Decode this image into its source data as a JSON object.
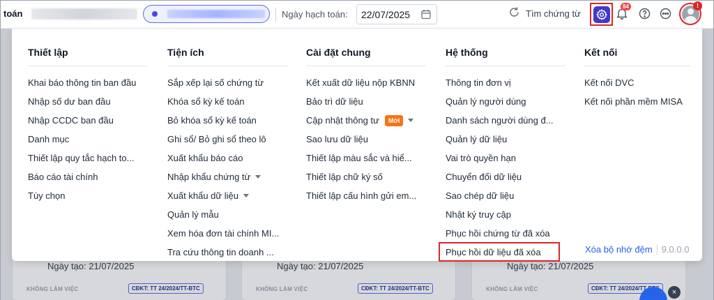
{
  "header": {
    "app_title": "toán",
    "date_label": "Ngày hạch toán:",
    "date_value": "22/07/2025",
    "search_doc_label": "Tìm chứng từ",
    "notification_count": "84",
    "avatar_alert": "!"
  },
  "menu": {
    "columns": [
      {
        "title": "Thiết lập",
        "items": [
          {
            "label": "Khai báo thông tin ban đầu"
          },
          {
            "label": "Nhập số dư ban đầu"
          },
          {
            "label": "Nhập CCDC ban đầu"
          },
          {
            "label": "Danh mục"
          },
          {
            "label": "Thiết lập quy tắc hạch to..."
          },
          {
            "label": "Báo cáo tài chính"
          },
          {
            "label": "Tùy chọn"
          }
        ]
      },
      {
        "title": "Tiện ích",
        "items": [
          {
            "label": "Sắp xếp lại số chứng từ"
          },
          {
            "label": "Khóa sổ kỳ kế toán"
          },
          {
            "label": "Bỏ khóa sổ kỳ kế toán"
          },
          {
            "label": "Ghi sổ/ Bỏ ghi sổ theo lô"
          },
          {
            "label": "Xuất khẩu báo cáo"
          },
          {
            "label": "Nhập khẩu chứng từ"
          },
          {
            "label": "Xuất khẩu dữ liệu"
          },
          {
            "label": "Quản lý mẫu"
          },
          {
            "label": "Xem hóa đơn tài chính MI..."
          },
          {
            "label": "Tra cứu thông tin doanh ..."
          }
        ]
      },
      {
        "title": "Cài đặt chung",
        "items": [
          {
            "label": "Kết xuất dữ liệu nộp KBNN"
          },
          {
            "label": "Bảo trì dữ liệu"
          },
          {
            "label": "Cập nhật thông tư",
            "badge": "Mới"
          },
          {
            "label": "Sao lưu dữ liệu"
          },
          {
            "label": "Thiết lập màu sắc và hiể..."
          },
          {
            "label": "Thiết lập chữ ký số"
          },
          {
            "label": "Thiết lập cấu hình gửi em..."
          }
        ]
      },
      {
        "title": "Hệ thống",
        "items": [
          {
            "label": "Thông tin đơn vị"
          },
          {
            "label": "Quản lý người dùng"
          },
          {
            "label": "Danh sách người dùng đ..."
          },
          {
            "label": "Quản lý dữ liệu"
          },
          {
            "label": "Vai trò quyền hạn"
          },
          {
            "label": "Chuyển đổi dữ liệu"
          },
          {
            "label": "Sao chép dữ liệu"
          },
          {
            "label": "Nhật ký truy cập"
          },
          {
            "label": "Phục hồi chứng từ đã xóa"
          },
          {
            "label": "Phục hồi dữ liệu đã xóa"
          }
        ]
      },
      {
        "title": "Kết nối",
        "items": [
          {
            "label": "Kết nối DVC"
          },
          {
            "label": "Kết nối phần mềm MISA"
          }
        ]
      }
    ],
    "clear_cache": "Xóa bộ nhớ đệm",
    "version": "9.0.0.0"
  },
  "background": {
    "cards": [
      {
        "created": "Ngày tạo: 21/07/2025",
        "status": "KHÔNG LÀM VIỆC",
        "tag": "CĐKT: TT 24/2024/TT-BTC"
      },
      {
        "created": "Ngày tạo: 21/07/2025",
        "status": "KHÔNG LÀM VIỆC",
        "tag": "CĐKT: TT 24/2024/TT-BTC"
      },
      {
        "created": "Ngày tạo: 21/07/2025",
        "status": "KHÔNG LÀM VIỆC",
        "tag": "CĐKT: TT 24/2024/TT-BTC"
      }
    ]
  },
  "colors": {
    "accent": "#4338ca",
    "highlight": "#dc2626",
    "new_badge": "#f97316",
    "link": "#2563eb"
  }
}
